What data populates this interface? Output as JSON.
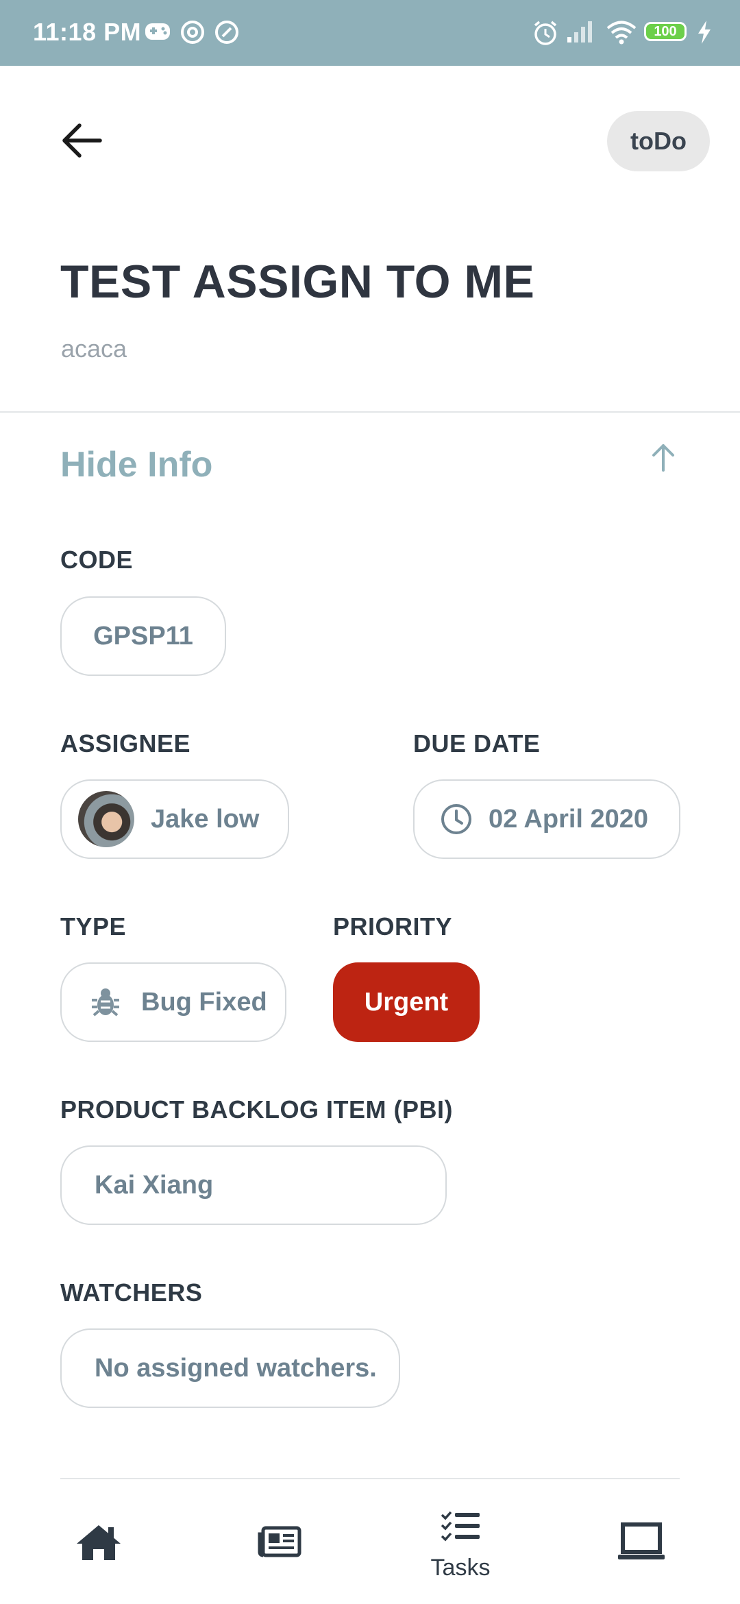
{
  "status_bar": {
    "time": "11:18 PM",
    "battery": "100",
    "icons": [
      "gamepad-icon",
      "at-sign-icon",
      "at-sign-icon",
      "alarm-icon",
      "signal-icon",
      "wifi-icon",
      "battery-icon",
      "charging-icon"
    ]
  },
  "header": {
    "back_icon": "arrow-left-icon",
    "status": "toDo",
    "title": "TEST ASSIGN TO ME",
    "subtitle": "acaca"
  },
  "info_section": {
    "toggle_label": "Hide Info",
    "toggle_icon": "arrow-up-icon",
    "code": {
      "label": "CODE",
      "value": "GPSP11"
    },
    "assignee": {
      "label": "ASSIGNEE",
      "name": "Jake low"
    },
    "due_date": {
      "label": "DUE DATE",
      "value": "02 April 2020",
      "icon": "clock-icon"
    },
    "type": {
      "label": "TYPE",
      "value": "Bug Fixed",
      "icon": "bug-icon"
    },
    "priority": {
      "label": "PRIORITY",
      "value": "Urgent",
      "color": "#bd2412"
    },
    "pbi": {
      "label": "PRODUCT BACKLOG ITEM (PBI)",
      "value": "Kai Xiang"
    },
    "watchers": {
      "label": "WATCHERS",
      "value": "No assigned watchers."
    }
  },
  "bottom_nav": {
    "items": [
      {
        "icon": "home-icon",
        "label": ""
      },
      {
        "icon": "newspaper-icon",
        "label": ""
      },
      {
        "icon": "tasks-list-icon",
        "label": "Tasks"
      },
      {
        "icon": "laptop-icon",
        "label": ""
      }
    ]
  },
  "colors": {
    "status_bar": "#8fb0b9",
    "accent": "#8fb0b9",
    "priority_urgent": "#bd2412",
    "text_dark": "#2f3a45",
    "chip_text": "#6d8290"
  }
}
